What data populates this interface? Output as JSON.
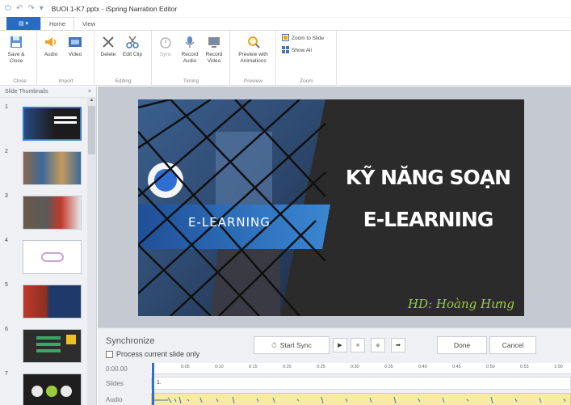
{
  "window": {
    "title": "BUOI 1-K7.pptx - iSpring Narration Editor"
  },
  "tabs": {
    "file_label": "▤ ▾",
    "home": "Home",
    "view": "View"
  },
  "ribbon": {
    "close_group": {
      "save_close": "Save & Close",
      "label": "Close"
    },
    "import_group": {
      "audio": "Audio",
      "video": "Video",
      "label": "Import"
    },
    "editing_group": {
      "delete": "Delete",
      "edit_clip": "Edit Clip",
      "label": "Editing"
    },
    "timing_group": {
      "sync": "Sync",
      "record_audio": "Record Audio",
      "record_video": "Record Video",
      "label": "Timing"
    },
    "preview_group": {
      "preview": "Preview with Animations",
      "label": "Preview"
    },
    "zoom_group": {
      "zoom_slide": "Zoom to Slide",
      "show_all": "Show All",
      "label": "Zoom"
    }
  },
  "left_panel": {
    "header": "Slide Thumbnails",
    "close": "×",
    "thumbnails": [
      "1",
      "2",
      "3",
      "4",
      "5",
      "6",
      "7"
    ]
  },
  "slide": {
    "title_line1": "KỸ NĂNG SOẠN",
    "title_line2": "E-LEARNING",
    "banner_text": "E-LEARNING",
    "signature": "HD: Hoàng Hưng"
  },
  "sync": {
    "title": "Synchronize",
    "checkbox_label": "Process current slide only",
    "start_sync": "Start Sync",
    "done": "Done",
    "cancel": "Cancel",
    "timeline": {
      "time": "0:00.00",
      "slides_label": "Slides",
      "audio_label": "Audio",
      "slide_marker": "1.",
      "ticks": [
        "0:05",
        "0:10",
        "0:15",
        "0:20",
        "0:25",
        "0:30",
        "0:35",
        "0:40",
        "0:45",
        "0:50",
        "0:55",
        "1:00"
      ]
    }
  },
  "colors": {
    "accent": "#2b6bbf",
    "stage": "#c4c9d2",
    "audio": "#f7e9a6",
    "signature": "#9ccc3a"
  }
}
